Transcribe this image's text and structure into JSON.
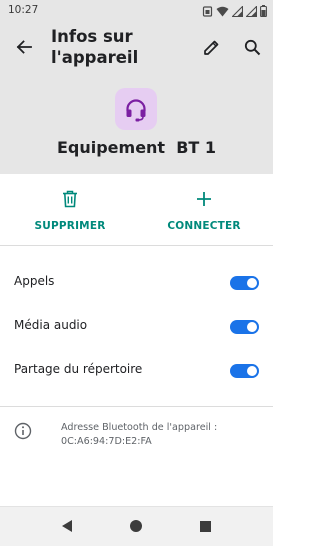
{
  "status_bar": {
    "time": "10:27",
    "icons": [
      "sim-card-icon",
      "wifi-icon",
      "signal-icon",
      "signal-icon",
      "battery-icon"
    ]
  },
  "app_bar": {
    "title_line1": "Infos sur",
    "title_line2": "l'appareil",
    "back_icon": "arrow-left-icon",
    "edit_icon": "pencil-icon",
    "search_icon": "search-icon"
  },
  "device": {
    "name": "Equipement  BT 1",
    "icon": "headset-icon",
    "icon_bg": "#e6cdf2",
    "icon_color": "#7b1fa2"
  },
  "actions": [
    {
      "label": "SUPPRIMER",
      "icon": "trash-icon"
    },
    {
      "label": "CONNECTER",
      "icon": "plus-icon"
    }
  ],
  "accent_color": "#00897b",
  "switch_color": "#1a73e8",
  "toggles": [
    {
      "label": "Appels",
      "on": true
    },
    {
      "label": "Média audio",
      "on": true
    },
    {
      "label": "Partage du répertoire",
      "on": true
    }
  ],
  "info": {
    "line1": "Adresse Bluetooth de l'appareil :",
    "line2": "0C:A6:94:7D:E2:FA",
    "icon": "info-icon"
  },
  "nav_bar": {
    "icons": [
      "back-triangle-icon",
      "home-circle-icon",
      "recents-square-icon"
    ]
  }
}
